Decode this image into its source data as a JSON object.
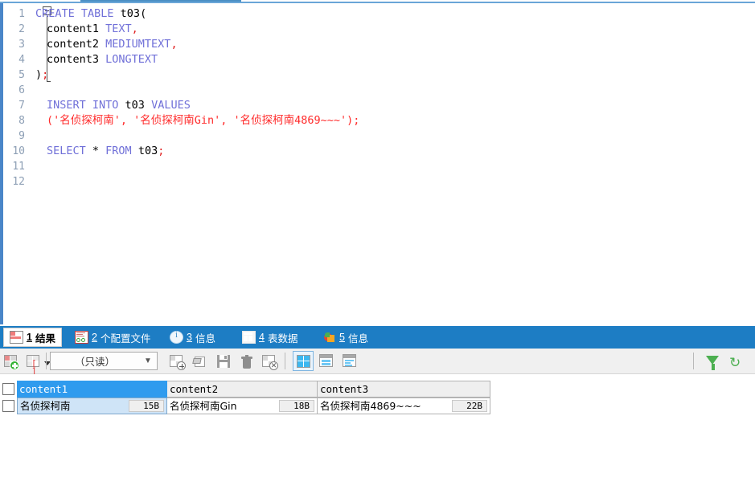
{
  "editor": {
    "line_numbers": [
      "1",
      "2",
      "3",
      "4",
      "5",
      "6",
      "7",
      "8",
      "9",
      "10",
      "11",
      "12"
    ],
    "lines": [
      {
        "n": "1",
        "segments": [
          {
            "t": "CREATE TABLE ",
            "c": "kw"
          },
          {
            "t": "t03",
            "c": "id"
          },
          {
            "t": "(",
            "c": "pun"
          }
        ]
      },
      {
        "n": "2",
        "segments": [
          {
            "t": "content1 ",
            "c": "id"
          },
          {
            "t": "TEXT",
            "c": "kw"
          },
          {
            "t": ",",
            "c": "red"
          }
        ]
      },
      {
        "n": "3",
        "segments": [
          {
            "t": "content2 ",
            "c": "id"
          },
          {
            "t": "MEDIUMTEXT",
            "c": "kw"
          },
          {
            "t": ",",
            "c": "red"
          }
        ]
      },
      {
        "n": "4",
        "segments": [
          {
            "t": "content3 ",
            "c": "id"
          },
          {
            "t": "LONGTEXT",
            "c": "kw"
          }
        ]
      },
      {
        "n": "5",
        "segments": [
          {
            "t": ")",
            "c": "pun"
          },
          {
            "t": ";",
            "c": "red"
          }
        ]
      },
      {
        "n": "6",
        "segments": []
      },
      {
        "n": "7",
        "segments": [
          {
            "t": "INSERT INTO ",
            "c": "kw"
          },
          {
            "t": "t03 ",
            "c": "id"
          },
          {
            "t": "VALUES",
            "c": "kw"
          }
        ]
      },
      {
        "n": "8",
        "segments": [
          {
            "t": "('名侦探柯南', '名侦探柯南Gin', '名侦探柯南4869~~~');",
            "c": "str"
          }
        ]
      },
      {
        "n": "9",
        "segments": []
      },
      {
        "n": "10",
        "segments": [
          {
            "t": "SELECT ",
            "c": "kw"
          },
          {
            "t": "* ",
            "c": "id"
          },
          {
            "t": "FROM ",
            "c": "kw"
          },
          {
            "t": "t03",
            "c": "id"
          },
          {
            "t": ";",
            "c": "red"
          }
        ]
      },
      {
        "n": "11",
        "segments": []
      },
      {
        "n": "12",
        "segments": []
      }
    ],
    "full_text": "CREATE TABLE t03(\n  content1 TEXT,\n  content2 MEDIUMTEXT,\n  content3 LONGTEXT\n);\n\nINSERT INTO t03 VALUES\n('名侦探柯南', '名侦探柯南Gin', '名侦探柯南4869~~~');\n\nSELECT * FROM t03;\n\n"
  },
  "result_tabs": [
    {
      "num": "1",
      "label": "结果",
      "icon": "grid-red-icon",
      "active": true
    },
    {
      "num": "2",
      "label": "个配置文件",
      "icon": "profile-icon",
      "active": false
    },
    {
      "num": "3",
      "label": "信息",
      "icon": "info-icon",
      "active": false
    },
    {
      "num": "4",
      "label": "表数据",
      "icon": "table-data-icon",
      "active": false
    },
    {
      "num": "5",
      "label": "信息",
      "icon": "pie-chart-icon",
      "active": false
    }
  ],
  "result_toolbar": {
    "buttons": [
      {
        "name": "add-record-button",
        "icon": "grid-add-icon"
      },
      {
        "name": "grid-options-button",
        "icon": "grid-brackets-icon"
      },
      {
        "name": "insert-record-button",
        "icon": "grid-plus-icon"
      },
      {
        "name": "edit-record-button",
        "icon": "pencil-grid-icon"
      },
      {
        "name": "apply-changes-button",
        "icon": "save-disk-icon"
      },
      {
        "name": "delete-record-button",
        "icon": "trash-icon"
      },
      {
        "name": "discard-changes-button",
        "icon": "grid-cancel-icon"
      },
      {
        "name": "grid-view-button",
        "icon": "grid-view-icon"
      },
      {
        "name": "form-view-button",
        "icon": "form-view-icon"
      },
      {
        "name": "text-view-button",
        "icon": "text-view-icon"
      },
      {
        "name": "filter-button",
        "icon": "filter-funnel-icon"
      },
      {
        "name": "refresh-button",
        "icon": "refresh-icon"
      }
    ],
    "mode_select": {
      "value": "（只读）",
      "arrow": "▼"
    },
    "active_view": "grid-view-button"
  },
  "result_grid": {
    "columns": [
      "content1",
      "content2",
      "content3"
    ],
    "selected_column": "content1",
    "rows": [
      {
        "checked": false,
        "cells": [
          {
            "value": "名侦探柯南",
            "size": "15B",
            "selected": true
          },
          {
            "value": "名侦探柯南Gin",
            "size": "18B",
            "selected": false
          },
          {
            "value": "名侦探柯南4869~~~",
            "size": "22B",
            "selected": false
          }
        ]
      }
    ]
  },
  "colors": {
    "tabbar_blue": "#1d7dc4",
    "header_select_blue": "#2f9bee",
    "cell_select_blue": "#cfe4f7",
    "keyword_violet": "#7070d8",
    "string_red": "#ff2b2b",
    "gutter_number": "#8d9fb5",
    "accent_green": "#4caf50"
  }
}
